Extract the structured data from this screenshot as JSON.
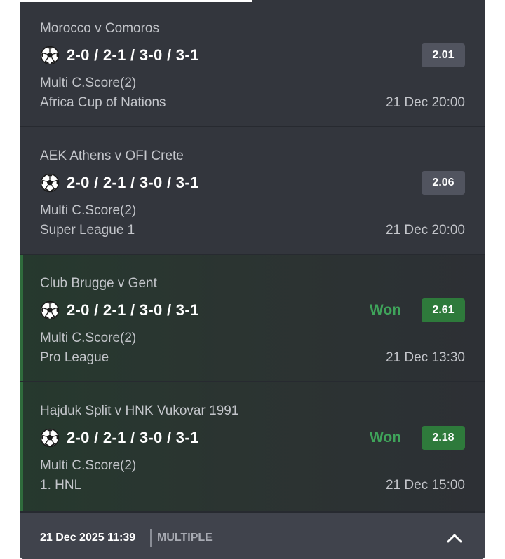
{
  "selections": [
    {
      "match": "Morocco v Comoros",
      "pick": "2-0 / 2-1 / 3-0 / 3-1",
      "odds": "2.01",
      "market": "Multi C.Score(2)",
      "league": "Africa Cup of Nations",
      "datetime": "21 Dec 20:00",
      "result": ""
    },
    {
      "match": "AEK Athens v OFI Crete",
      "pick": "2-0 / 2-1 / 3-0 / 3-1",
      "odds": "2.06",
      "market": "Multi C.Score(2)",
      "league": "Super League 1",
      "datetime": "21 Dec 20:00",
      "result": ""
    },
    {
      "match": "Club Brugge v Gent",
      "pick": "2-0 / 2-1 / 3-0 / 3-1",
      "odds": "2.61",
      "market": "Multi C.Score(2)",
      "league": "Pro League",
      "datetime": "21 Dec 13:30",
      "result": "Won"
    },
    {
      "match": "Hajduk Split v HNK Vukovar 1991",
      "pick": "2-0 / 2-1 / 3-0 / 3-1",
      "odds": "2.18",
      "market": "Multi C.Score(2)",
      "league": "1. HNL",
      "datetime": "21 Dec 15:00",
      "result": "Won"
    }
  ],
  "footer": {
    "placed_at": "21 Dec 2025 11:39",
    "bet_type": "MULTIPLE",
    "toggle_icon": "chevron-up-icon"
  },
  "colors": {
    "card_bg": "#33363d",
    "footer_bg": "#40434c",
    "odds_badge_bg": "#51545f",
    "won_badge_bg": "#2e7a3b",
    "won_text": "#3fa35a"
  }
}
